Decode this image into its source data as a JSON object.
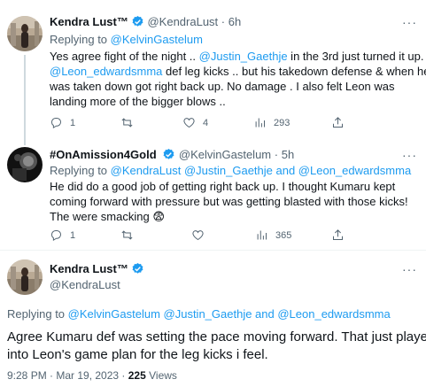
{
  "tweets": [
    {
      "name": "Kendra Lust™",
      "handle": "@KendraLust",
      "sep": "·",
      "time": "6h",
      "replying_to_label": "Replying to",
      "replying_to": "@KelvinGastelum",
      "lines": [
        [
          "Yes agree fight of the night ..  ",
          "@Justin_Gaethje",
          " in the 3rd just turned it up."
        ],
        [
          "@Leon_edwardsmma",
          " def leg kicks .. but his takedown defense & when he"
        ],
        [
          "was taken down got right back up. No damage . I also felt Leon was"
        ],
        [
          "landing more of the bigger blows .."
        ]
      ],
      "replies": "1",
      "retweets": "",
      "likes": "4",
      "views": "293"
    },
    {
      "name": "#OnAmission4Gold",
      "handle": "@KelvinGastelum",
      "sep": "·",
      "time": "5h",
      "replying_to_label": "Replying to",
      "replying_to": "@KendraLust @Justin_Gaethje and @Leon_edwardsmma",
      "lines": [
        "He did do a good job of getting right back up. I thought Kumaru kept",
        "coming forward with pressure but was getting blasted with those kicks!",
        "The were smacking 😨"
      ],
      "replies": "1",
      "retweets": "",
      "likes": "",
      "views": "365"
    }
  ],
  "main": {
    "name": "Kendra Lust™",
    "handle": "@KendraLust",
    "replying_to_label": "Replying to",
    "replying_to": "@KelvinGastelum @Justin_Gaethje and @Leon_edwardsmma",
    "lines": [
      "Agree Kumaru def was setting the pace moving forward. That just played",
      "into Leon's game plan for the leg kicks i feel."
    ],
    "time": "9:28 PM · Mar 19, 2023 ·",
    "views_count": "225",
    "views_label": "Views"
  },
  "colors": {
    "accent": "#1d9bf0",
    "muted": "#536471",
    "text": "#0f1419"
  }
}
